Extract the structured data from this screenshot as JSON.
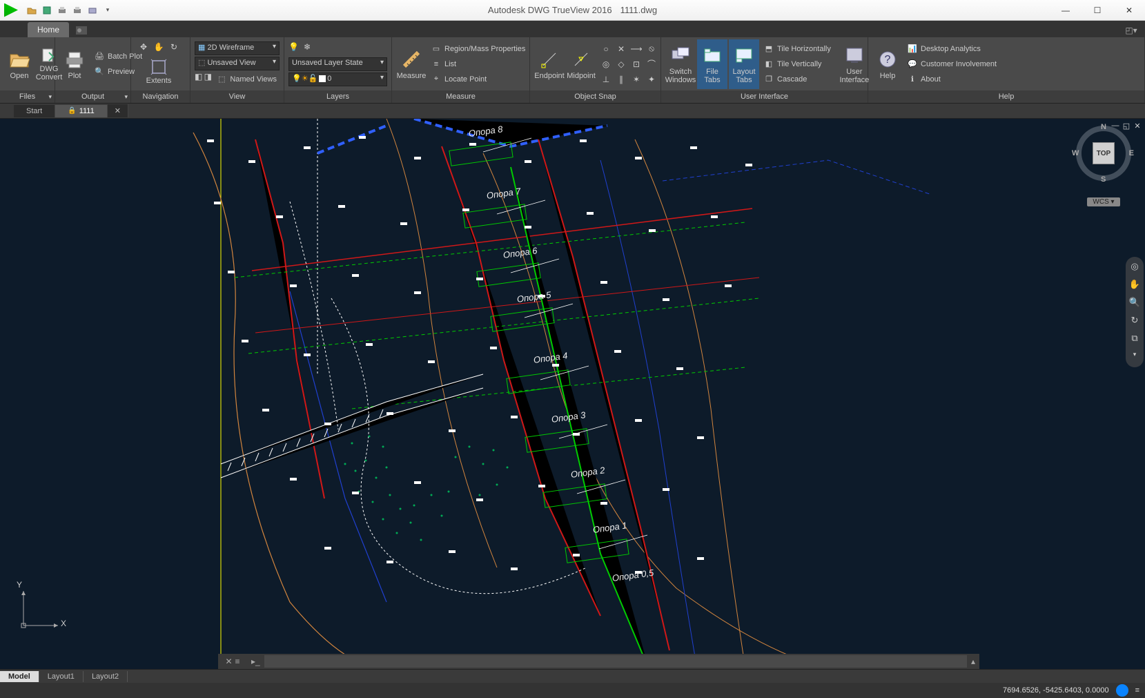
{
  "app": {
    "name": "Autodesk DWG TrueView 2016",
    "file": "1111.dwg"
  },
  "ribbon_tab": "Home",
  "panels": {
    "files": {
      "label": "Files",
      "open": "Open",
      "dwgconvert": "DWG\nConvert"
    },
    "output": {
      "label": "Output",
      "plot": "Plot",
      "batch": "Batch Plot",
      "preview": "Preview"
    },
    "navigation": {
      "label": "Navigation",
      "extents": "Extents"
    },
    "view": {
      "label": "View",
      "style_dd": "2D Wireframe",
      "view_dd": "Unsaved View",
      "named": "Named Views"
    },
    "layers": {
      "label": "Layers",
      "state_dd": "Unsaved Layer State",
      "current_dd": "0"
    },
    "measure": {
      "label": "Measure",
      "btn": "Measure",
      "region": "Region/Mass Properties",
      "list": "List",
      "locate": "Locate Point"
    },
    "osnap": {
      "label": "Object Snap",
      "endpoint": "Endpoint",
      "midpoint": "Midpoint"
    },
    "ui": {
      "label": "User Interface",
      "switch": "Switch\nWindows",
      "filetabs": "File Tabs",
      "layouttabs": "Layout\nTabs",
      "tileh": "Tile Horizontally",
      "tilev": "Tile Vertically",
      "cascade": "Cascade",
      "uibtn": "User\nInterface"
    },
    "help": {
      "label": "Help",
      "help": "Help",
      "analytics": "Desktop Analytics",
      "involve": "Customer Involvement",
      "about": "About"
    }
  },
  "filetabs": {
    "start": "Start",
    "current": "1111"
  },
  "viewcube": {
    "face": "TOP",
    "n": "N",
    "s": "S",
    "e": "E",
    "w": "W",
    "wcs": "WCS"
  },
  "layout_tabs": {
    "model": "Model",
    "l1": "Layout1",
    "l2": "Layout2"
  },
  "status": {
    "coords": "7694.6526, -5425.6403, 0.0000"
  },
  "ucs": {
    "x": "X",
    "y": "Y"
  },
  "annotations": [
    "Опора 8",
    "Опора 7",
    "Опора 6",
    "Опора 5",
    "Опора 4",
    "Опора 3",
    "Опора 2",
    "Опора 1",
    "Опора 0,5"
  ]
}
